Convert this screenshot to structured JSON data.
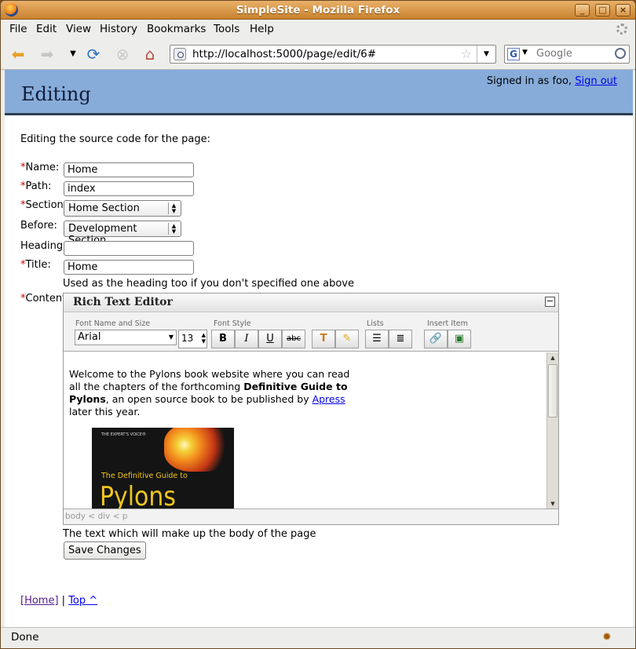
{
  "window": {
    "title": "SimpleSite - Mozilla Firefox"
  },
  "menu": [
    "File",
    "Edit",
    "View",
    "History",
    "Bookmarks",
    "Tools",
    "Help"
  ],
  "nav": {
    "url": "http://localhost:5000/page/edit/6#",
    "search_placeholder": "Google"
  },
  "header": {
    "title": "Editing",
    "signed_in": "Signed in as foo,",
    "sign_out": "Sign out"
  },
  "form": {
    "intro": "Editing the source code for the page:",
    "required_mark": "*",
    "name_label": "Name:",
    "name_value": "Home",
    "path_label": "Path:",
    "path_value": "index",
    "section_label": "Section:",
    "section_value": "Home Section",
    "before_label": "Before:",
    "before_value": "Development Section",
    "heading_label": "Heading:",
    "heading_value": "",
    "title_label": "Title:",
    "title_value": "Home",
    "title_hint": "Used as the heading too if you don't specified one above",
    "content_label": "Content:",
    "content_hint": "The text which will make up the body of the page",
    "save_label": "Save Changes"
  },
  "editor": {
    "title": "Rich Text Editor",
    "collapse": "−",
    "groups": {
      "font": "Font Name and Size",
      "style": "Font Style",
      "lists": "Lists",
      "insert": "Insert Item"
    },
    "font_name": "Arial",
    "font_size": "13",
    "buttons": {
      "bold": "B",
      "italic": "I",
      "underline": "U",
      "strike": "abc"
    },
    "body_before": "Welcome to the Pylons book website where you can read all the chapters of the forthcoming ",
    "body_bold": "Definitive Guide to Pylons",
    "body_mid": ", an open source book to be published by ",
    "body_link": "Apress",
    "body_after": " later this year.",
    "cover_top": "THE EXPERT'S VOICE®",
    "cover_title": "The Definitive Guide to",
    "cover_big": "Pylons",
    "path": "body < div < p"
  },
  "footer": {
    "home": "[Home]",
    "sep": " | ",
    "top": "Top ^"
  },
  "status": {
    "text": "Done"
  },
  "colors": {
    "header_bg": "#87acd9",
    "titlebar": "#d4913e"
  }
}
